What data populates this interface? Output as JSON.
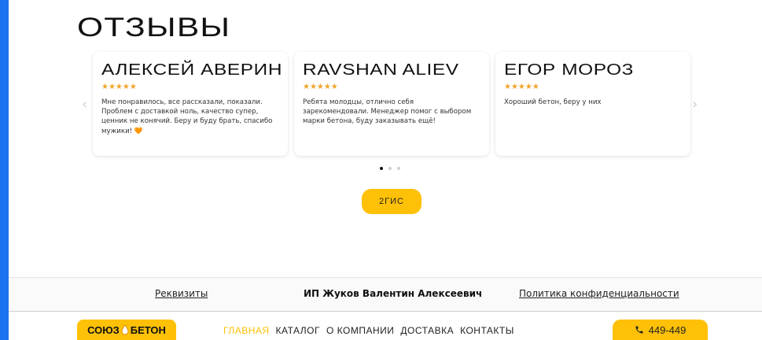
{
  "reviews": {
    "title": "ОТЗЫВЫ",
    "prev_arrow": "‹",
    "next_arrow": "›",
    "cards": [
      {
        "name": "АЛЕКСЕЙ АВЕРИН",
        "stars": "★★★★★",
        "rating": 5,
        "text": "Мне понравилось, все рассказали, показали. Проблем с доставкой ноль, качество супер, ценник не конячий. Беру и буду брать, спасибо мужики! 🧡"
      },
      {
        "name": "RAVSHAN ALIEV",
        "stars": "★★★★★",
        "rating": 5,
        "text": "Ребята молодцы, отлично себя зарекомендовали. Менеджер помог с выбором марки бетона, буду заказывать ещё!"
      },
      {
        "name": "ЕГОР МОРОЗ",
        "stars": "★★★★★",
        "rating": 5,
        "text": "Хороший бетон, беру у них"
      }
    ],
    "pagination": {
      "current": 1,
      "total": 3
    },
    "gis_button": "2ГИС"
  },
  "footer": {
    "requisites_link": "Реквизиты",
    "owner": "ИП Жуков Валентин Алексеевич",
    "privacy_link": "Политика конфиденциальности"
  },
  "header": {
    "logo_left": "СОЮЗ",
    "logo_right": "БЕТОН",
    "nav": [
      {
        "label": "ГЛАВНАЯ",
        "active": true
      },
      {
        "label": "КАТАЛОГ",
        "active": false
      },
      {
        "label": "О КОМПАНИИ",
        "active": false
      },
      {
        "label": "ДОСТАВКА",
        "active": false
      },
      {
        "label": "КОНТАКТЫ",
        "active": false
      }
    ],
    "phone": "449-449"
  },
  "colors": {
    "accent": "#ffc107",
    "star": "#f0a52a",
    "side_strip": "#1a73f0"
  }
}
